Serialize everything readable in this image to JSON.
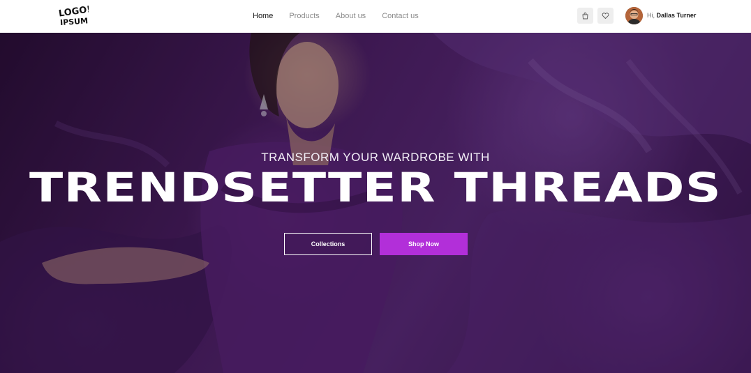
{
  "header": {
    "logo_text": "LOGO IPSUM",
    "nav": [
      {
        "label": "Home",
        "active": true
      },
      {
        "label": "Products",
        "active": false
      },
      {
        "label": "About us",
        "active": false
      },
      {
        "label": "Contact us",
        "active": false
      }
    ],
    "icons": {
      "bag": "shopping-bag-icon",
      "wishlist": "heart-icon"
    },
    "greeting_prefix": "Hi, ",
    "user_name": "Dallas Turner"
  },
  "hero": {
    "subtitle": "TRANSFORM YOUR WARDROBE WITH",
    "title": "TRENDSETTER THREADS",
    "buttons": {
      "collections": "Collections",
      "shop_now": "Shop Now"
    }
  },
  "colors": {
    "accent": "#b22fd9",
    "hero_background": "#4b1f62",
    "nav_active": "#1b1b1b",
    "nav_inactive": "#8b8b8b"
  }
}
